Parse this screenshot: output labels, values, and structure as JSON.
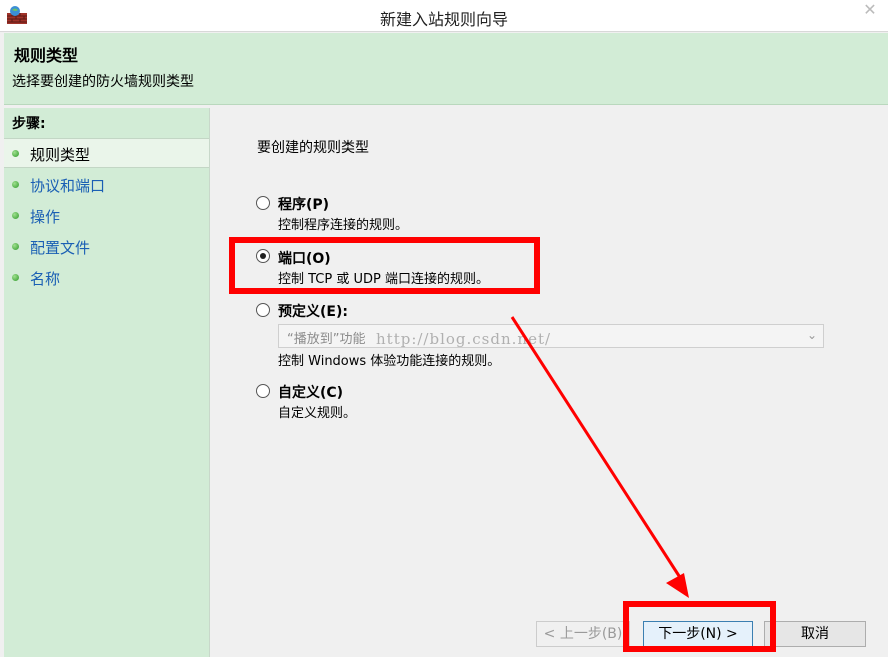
{
  "window": {
    "title": "新建入站规则向导",
    "app_icon": "firewall-icon",
    "close_glyph": "✕"
  },
  "header": {
    "title": "规则类型",
    "subtitle": "选择要创建的防火墙规则类型"
  },
  "sidebar": {
    "steps_label": "步骤:",
    "items": [
      {
        "label": "规则类型",
        "active": true
      },
      {
        "label": "协议和端口",
        "active": false
      },
      {
        "label": "操作",
        "active": false
      },
      {
        "label": "配置文件",
        "active": false
      },
      {
        "label": "名称",
        "active": false
      }
    ]
  },
  "main": {
    "prompt": "要创建的规则类型",
    "options": [
      {
        "label": "程序(P)",
        "description": "控制程序连接的规则。",
        "selected": false
      },
      {
        "label": "端口(O)",
        "description": "控制 TCP 或 UDP 端口连接的规则。",
        "selected": true
      },
      {
        "label": "预定义(E):",
        "description": "控制 Windows 体验功能连接的规则。",
        "selected": false
      },
      {
        "label": "自定义(C)",
        "description": "自定义规则。",
        "selected": false
      }
    ],
    "predefined_dropdown": {
      "value": "“播放到”功能"
    },
    "watermark": "http://blog.csdn.net/"
  },
  "buttons": {
    "back": "< 上一步(B)",
    "next": "下一步(N) >",
    "cancel": "取消"
  },
  "colors": {
    "panel_green": "#d2ecd6",
    "annotation_red": "#ff0000",
    "link_blue": "#1a5fb4"
  }
}
